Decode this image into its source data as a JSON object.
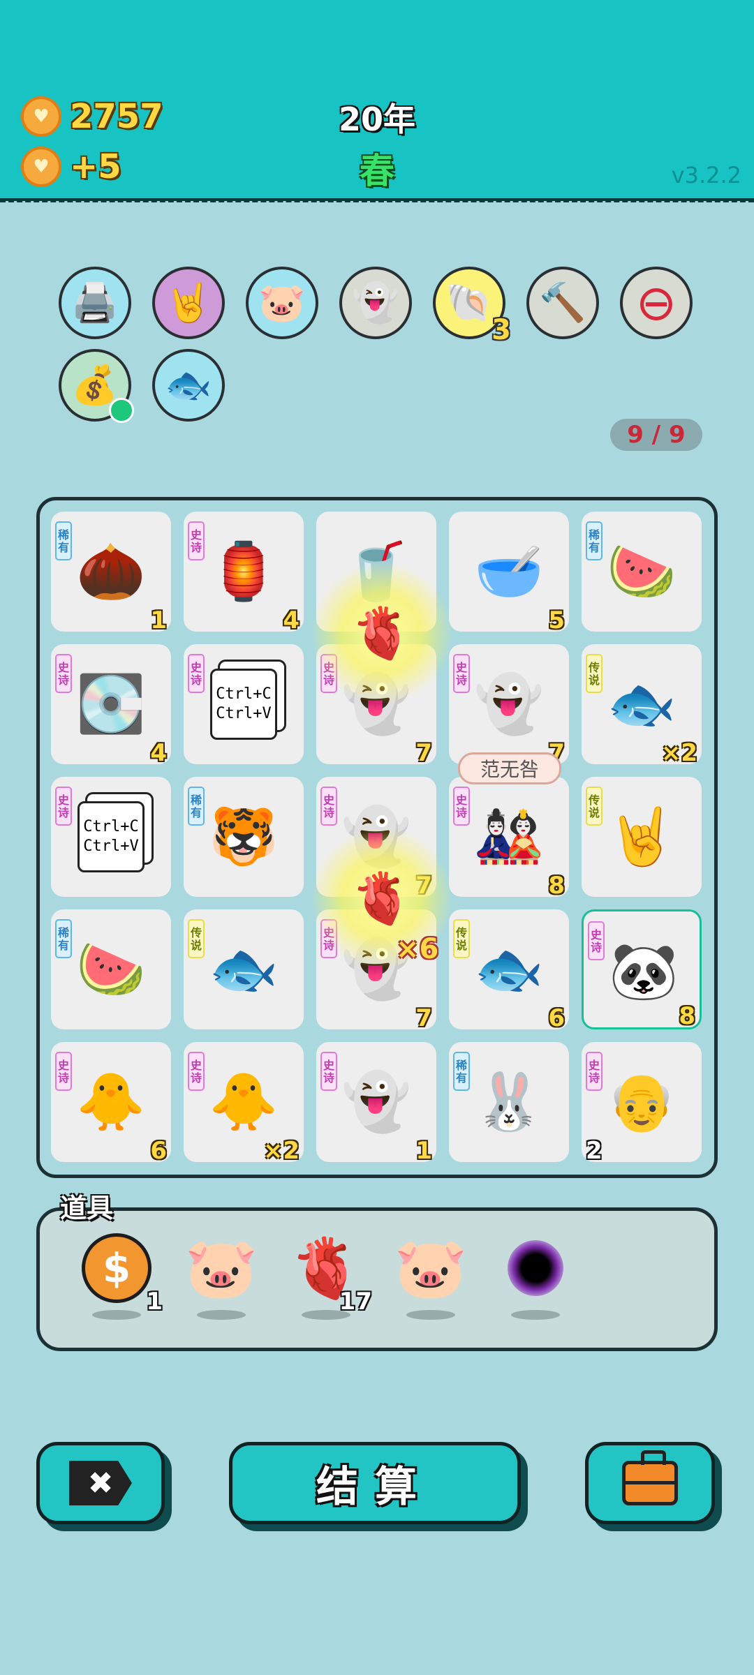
{
  "header": {
    "coins": "2757",
    "income": "+5",
    "year": "20年",
    "season": "春",
    "version": "v3.2.2",
    "coin_icon": "heart-coin-icon",
    "colors": {
      "header_bg": "#17c3c3",
      "coin_text": "#ffd943",
      "season": "#39e36a"
    }
  },
  "relics": [
    {
      "icon": "printer-warning-icon",
      "glyph": "🖨️",
      "bg": "#9fe3f0"
    },
    {
      "icon": "rock-hand-icon",
      "glyph": "🤘",
      "bg": "#cf9ad8"
    },
    {
      "icon": "piggy-bank-icon",
      "glyph": "🐷",
      "bg": "#9fe3f0"
    },
    {
      "icon": "ghost-tongue-icon",
      "glyph": "👻",
      "bg": "#d8dbd2"
    },
    {
      "icon": "shell-icon",
      "glyph": "🐚",
      "bg": "#fbf27a",
      "count": "3"
    },
    {
      "icon": "hammer-icon",
      "glyph": "🔨",
      "bg": "#d8dbd2"
    },
    {
      "icon": "minus-heart-icon",
      "glyph": "⊖",
      "bg": "#d8dbd2"
    },
    {
      "icon": "money-sack-icon",
      "glyph": "💰",
      "bg": "#b9e3c9"
    },
    {
      "icon": "fish-tank-icon",
      "glyph": "🐟",
      "bg": "#9fe3f0"
    }
  ],
  "spins": "9 / 9",
  "tooltip": "范无咎",
  "grid": [
    [
      {
        "icon": "walnut-icon",
        "glyph": "🌰",
        "rarity": "稀有",
        "rclass": "rare",
        "value": "1"
      },
      {
        "icon": "rabbit-house-icon",
        "glyph": "🏮",
        "rarity": "史诗",
        "rclass": "epic",
        "value": "4"
      },
      {
        "icon": "cup-icon",
        "glyph": "🥤",
        "value": ""
      },
      {
        "icon": "bowl-icon",
        "glyph": "🥣",
        "value": "5"
      },
      {
        "icon": "watermelon-icon",
        "glyph": "🍉",
        "rarity": "稀有",
        "rclass": "rare",
        "value": ""
      }
    ],
    [
      {
        "icon": "gpu-card-icon",
        "glyph": "💽",
        "rarity": "史诗",
        "rclass": "epic",
        "value": "4"
      },
      {
        "icon": "copy-paste-icon",
        "glyph": "📄",
        "rarity": "史诗",
        "rclass": "epic",
        "value": "",
        "text": "Ctrl+C Ctrl+V"
      },
      {
        "icon": "ghost-icon",
        "glyph": "👻",
        "rarity": "史诗",
        "rclass": "epic",
        "value": "7"
      },
      {
        "icon": "ghost-icon",
        "glyph": "👻",
        "rarity": "史诗",
        "rclass": "epic",
        "value": "7"
      },
      {
        "icon": "koi-fish-icon",
        "glyph": "🐟",
        "rarity": "传说",
        "rclass": "legend",
        "value": "×2"
      }
    ],
    [
      {
        "icon": "copy-paste-icon",
        "glyph": "📄",
        "rarity": "史诗",
        "rclass": "epic",
        "value": "",
        "text": "Ctrl+C Ctrl+V"
      },
      {
        "icon": "tiger-cat-icon",
        "glyph": "🐯",
        "rarity": "稀有",
        "rclass": "rare",
        "value": ""
      },
      {
        "icon": "ghost-star-icon",
        "glyph": "👻",
        "rarity": "史诗",
        "rclass": "epic",
        "value": "7"
      },
      {
        "icon": "black-white-impermanence-icon",
        "glyph": "🎎",
        "rarity": "史诗",
        "rclass": "epic",
        "value": "8"
      },
      {
        "icon": "rock-hand-icon",
        "glyph": "🤘",
        "rarity": "传说",
        "rclass": "legend",
        "value": ""
      }
    ],
    [
      {
        "icon": "watermelon-icon",
        "glyph": "🍉",
        "rarity": "稀有",
        "rclass": "rare",
        "value": ""
      },
      {
        "icon": "koi-fish-icon",
        "glyph": "🐟",
        "rarity": "传说",
        "rclass": "legend",
        "value": ""
      },
      {
        "icon": "ghost-icon",
        "glyph": "👻",
        "rarity": "史诗",
        "rclass": "epic",
        "value": "7"
      },
      {
        "icon": "koi-fish-icon",
        "glyph": "🐟",
        "rarity": "传说",
        "rclass": "legend",
        "value": "6"
      },
      {
        "icon": "panda-icon",
        "glyph": "🐼",
        "rarity": "史诗",
        "rclass": "epic",
        "value": "8",
        "selected": true
      }
    ],
    [
      {
        "icon": "yellow-chick-icon",
        "glyph": "🐥",
        "rarity": "史诗",
        "rclass": "epic",
        "value": "6"
      },
      {
        "icon": "yellow-chick-icon",
        "glyph": "🐥",
        "rarity": "史诗",
        "rclass": "epic",
        "value": "×2"
      },
      {
        "icon": "ghost-fortune-icon",
        "glyph": "👻",
        "rarity": "史诗",
        "rclass": "epic",
        "value": "1"
      },
      {
        "icon": "new-year-rabbit-icon",
        "glyph": "🐰",
        "rarity": "稀有",
        "rclass": "rare",
        "value": ""
      },
      {
        "icon": "grandpa-icon",
        "glyph": "👴",
        "rarity": "史诗",
        "rclass": "epic",
        "value": "2",
        "value_left": true
      }
    ]
  ],
  "effects": {
    "liver_glyph": "🫀",
    "multiplier": "×6"
  },
  "props": {
    "label": "道具",
    "items": [
      {
        "icon": "dollar-coin-icon",
        "glyph": "$",
        "count": "1"
      },
      {
        "icon": "piggy-bank-icon",
        "glyph": "🐷",
        "count": ""
      },
      {
        "icon": "liver-icon",
        "glyph": "🫀",
        "count": "17"
      },
      {
        "icon": "piggy-bank-icon",
        "glyph": "🐷",
        "count": ""
      },
      {
        "icon": "black-hole-icon",
        "glyph": "",
        "count": ""
      }
    ]
  },
  "buttons": {
    "skip_glyph": "✖",
    "settle": "结算"
  }
}
